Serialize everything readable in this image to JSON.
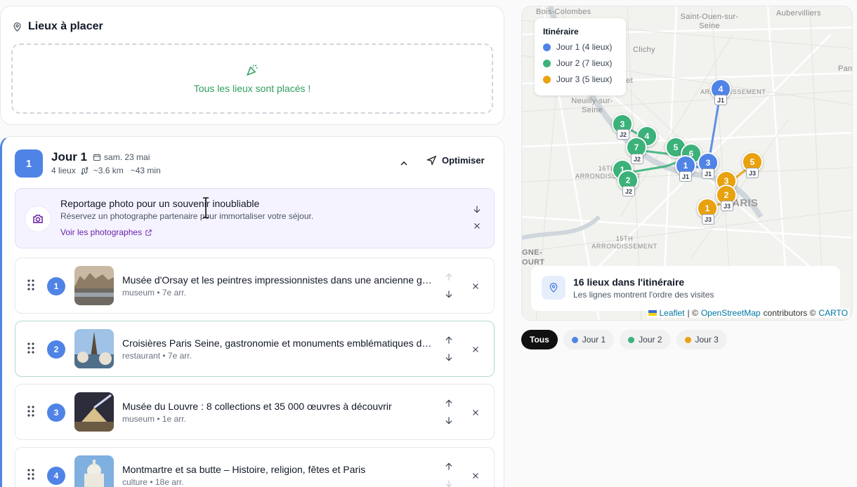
{
  "places": {
    "title": "Lieux à placer",
    "empty_message": "Tous les lieux sont placés !"
  },
  "day": {
    "badge": "1",
    "title": "Jour 1",
    "date": "sam. 23 mai",
    "count": "4 lieux",
    "distance": "~3.6 km",
    "duration": "~43 min",
    "optimize_label": "Optimiser"
  },
  "promo": {
    "title": "Reportage photo pour un souvenir inoubliable",
    "subtitle": "Réservez un photographe partenaire pour immortaliser votre séjour.",
    "link": "Voir les photographes"
  },
  "items": [
    {
      "num": "1",
      "name": "Musée d'Orsay et les peintres impressionnistes dans une ancienne gare",
      "sub": "museum • 7e arr."
    },
    {
      "num": "2",
      "name": "Croisières Paris Seine, gastronomie et monuments emblématiques de Paris",
      "sub": "restaurant • 7e arr."
    },
    {
      "num": "3",
      "name": "Musée du Louvre : 8 collections et 35 000 œuvres à découvrir",
      "sub": "museum • 1e arr."
    },
    {
      "num": "4",
      "name": "Montmartre et sa butte – Histoire, religion, fêtes et Paris",
      "sub": "culture • 18e arr."
    }
  ],
  "map": {
    "legend_title": "Itinéraire",
    "legend": [
      {
        "label": "Jour 1 (4 lieux)",
        "color": "#4f83e6"
      },
      {
        "label": "Jour 2 (7 lieux)",
        "color": "#3bb27a"
      },
      {
        "label": "Jour 3 (5 lieux)",
        "color": "#e8a20f"
      }
    ],
    "labels": {
      "bois": "Bois-Colombes",
      "saintouen": "Saint-Ouen-sur-Seine",
      "aubervilliers": "Aubervilliers",
      "clichy": "Clichy",
      "pantin": "Panti",
      "neuilly": "Neuilly-sur-Seine",
      "levallois": "errret",
      "arr18": "ARRONDISSEMENT",
      "arr16": "16TH ARRONDISSEMENT",
      "arr15": "15TH ARRONDISSEMENT",
      "paris": "PARIS",
      "issy": "GNE-OURT"
    },
    "footer_title": "16 lieux dans l'itinéraire",
    "footer_sub": "Les lignes montrent l'ordre des visites",
    "attribution_leaflet": "Leaflet",
    "attribution_sep": "| ©",
    "attribution_osm": "OpenStreetMap",
    "attribution_contrib": "contributors ©",
    "attribution_carto": "CARTO"
  },
  "filters": [
    {
      "label": "Tous"
    },
    {
      "label": "Jour 1",
      "color": "#4f83e6"
    },
    {
      "label": "Jour 2",
      "color": "#3bb27a"
    },
    {
      "label": "Jour 3",
      "color": "#e8a20f"
    }
  ],
  "pins": {
    "j1": "J1",
    "j2": "J2",
    "j3": "J3",
    "n1": "1",
    "n2": "2",
    "n3": "3",
    "n4": "4",
    "n5": "5",
    "n6": "6",
    "n7": "7"
  }
}
